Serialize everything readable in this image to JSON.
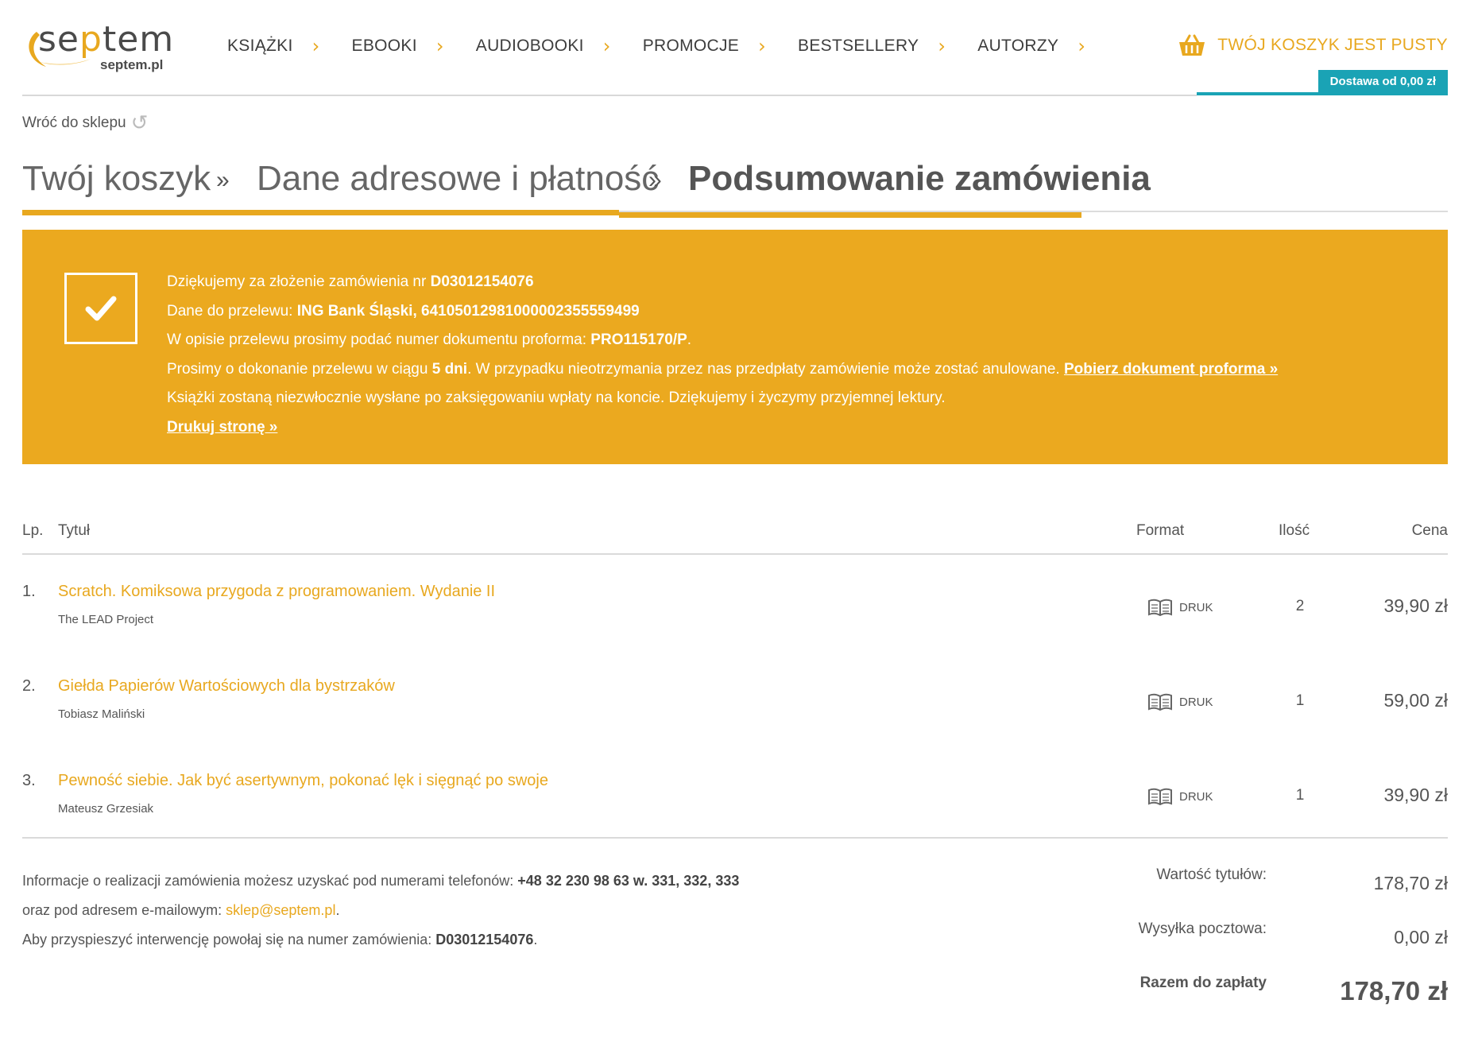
{
  "header": {
    "logo_word_a": "se",
    "logo_word_p": "p",
    "logo_word_b": "tem",
    "logo_domain": "septem.pl",
    "nav": [
      {
        "label": "KSIĄŻKI"
      },
      {
        "label": "EBOOKI"
      },
      {
        "label": "AUDIOBOOKI"
      },
      {
        "label": "PROMOCJE"
      },
      {
        "label": "BESTSELLERY"
      },
      {
        "label": "AUTORZY"
      }
    ],
    "cart_text": "TWÓJ KOSZYK JEST PUSTY",
    "delivery_text": "Dostawa od 0,00 zł"
  },
  "back_link": "Wróć do sklepu",
  "steps": [
    {
      "label": "Twój koszyk"
    },
    {
      "label": "Dane adresowe i płatność"
    },
    {
      "label": "Podsumowanie zamówienia"
    }
  ],
  "steps_sep": "»",
  "banner": {
    "line1_prefix": "Dziękujemy za złożenie zamówienia nr ",
    "order_number": "D03012154076",
    "line2_prefix": "Dane do przelewu: ",
    "bank_details": "ING Bank Śląski, 64105012981000002355559499",
    "line3_prefix": "W opisie przelewu prosimy podać numer dokumentu proforma: ",
    "proforma_number": "PRO115170/P",
    "line3_suffix": ".",
    "line4_prefix": "Prosimy o dokonanie przelewu w ciągu ",
    "days": "5 dni",
    "line4_middle": ". W przypadku nieotrzymania przez nas przedpłaty zamówienie może zostać anulowane. ",
    "download_link": "Pobierz dokument proforma »",
    "line5": "Książki zostaną niezwłocznie wysłane po zaksięgowaniu wpłaty na koncie. Dziękujemy i życzymy przyjemnej lektury.",
    "print_link": "Drukuj stronę »"
  },
  "table": {
    "headers": {
      "lp": "Lp.",
      "title": "Tytuł",
      "format": "Format",
      "qty": "Ilość",
      "price": "Cena"
    },
    "rows": [
      {
        "lp": "1.",
        "title": "Scratch. Komiksowa przygoda z programowaniem. Wydanie II",
        "author": "The LEAD Project",
        "format": "DRUK",
        "qty": "2",
        "price": "39,90 zł"
      },
      {
        "lp": "2.",
        "title": "Giełda Papierów Wartościowych dla bystrzaków",
        "author": "Tobiasz Maliński",
        "format": "DRUK",
        "qty": "1",
        "price": "59,00 zł"
      },
      {
        "lp": "3.",
        "title": "Pewność siebie. Jak być asertywnym, pokonać lęk i sięgnąć po swoje",
        "author": "Mateusz Grzesiak",
        "format": "DRUK",
        "qty": "1",
        "price": "39,90 zł"
      }
    ]
  },
  "info": {
    "line1_prefix": "Informacje o realizacji zamówienia możesz uzyskać pod numerami telefonów: ",
    "phones": "+48 32 230 98 63 w. 331, 332, 333",
    "line2_prefix": "oraz pod adresem e-mailowym: ",
    "email": "sklep@septem.pl",
    "line2_suffix": ".",
    "line3_prefix": "Aby przyspieszyć interwencję powołaj się na numer zamówienia: ",
    "order_number": "D03012154076",
    "line3_suffix": "."
  },
  "totals": [
    {
      "label": "Wartość tytułów:",
      "value": "178,70 zł"
    },
    {
      "label": "Wysyłka pocztowa:",
      "value": "0,00 zł"
    },
    {
      "label": "Razem do zapłaty",
      "value": "178,70 zł"
    }
  ],
  "colors": {
    "accent": "#e8a81f",
    "banner": "#eba91f",
    "teal": "#1aa3b5"
  }
}
